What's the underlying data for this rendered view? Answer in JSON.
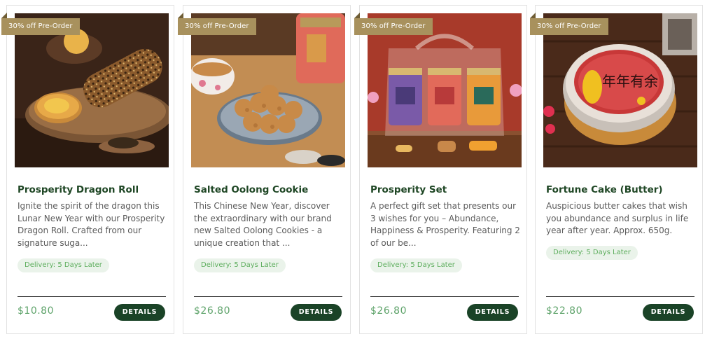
{
  "products": [
    {
      "badge": "30% off Pre-Order",
      "title": "Prosperity Dragon Roll",
      "description": "Ignite the spirit of the dragon this Lunar New Year with our Prosperity Dragon Roll. Crafted from our signature suga...",
      "delivery": "Delivery: 5 Days Later",
      "price": "$10.80",
      "button": "DETAILS"
    },
    {
      "badge": "30% off Pre-Order",
      "title": "Salted Oolong Cookie",
      "description": "This Chinese New Year, discover the extraordinary with our brand new Salted Oolong Cookies - a unique creation that ...",
      "delivery": "Delivery: 5 Days Later",
      "price": "$26.80",
      "button": "DETAILS"
    },
    {
      "badge": "30% off Pre-Order",
      "title": "Prosperity Set",
      "description": "A perfect gift set that presents our 3 wishes for you – Abundance, Happiness & Prosperity. Featuring 2 of our be...",
      "delivery": "Delivery: 5 Days Later",
      "price": "$26.80",
      "button": "DETAILS"
    },
    {
      "badge": "30% off Pre-Order",
      "title": "Fortune Cake (Butter)",
      "description": "Auspicious butter cakes that wish you abundance and surplus in life year after year. Approx. 650g.",
      "delivery": "Delivery: 5 Days Later",
      "price": "$22.80",
      "button": "DETAILS",
      "cake_text": "年年有余"
    }
  ],
  "colors": {
    "badge": "#a8915d",
    "title": "#1e4624",
    "price": "#5ea36a",
    "button": "#1a4327",
    "delivery_bg": "#eaf3ea",
    "delivery_text": "#5eae5e"
  }
}
